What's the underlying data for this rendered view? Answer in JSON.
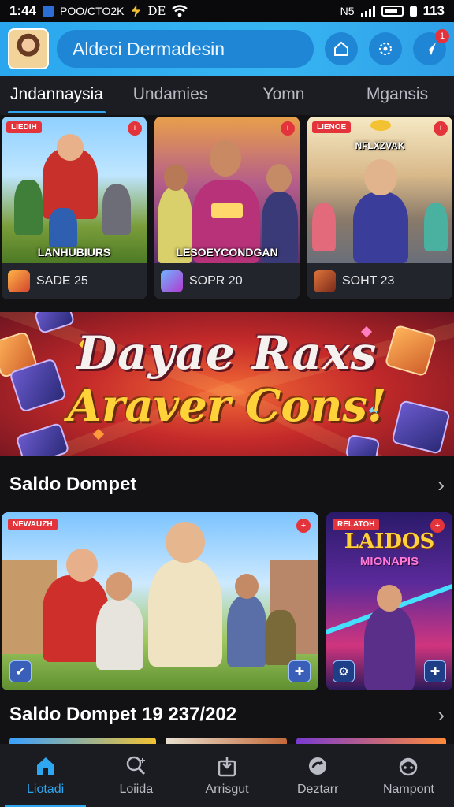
{
  "status_bar": {
    "time": "1:44",
    "carrier": "POO/CTO2K",
    "extra": "DE",
    "network": "N5",
    "battery": "113"
  },
  "header": {
    "search_text": "Aldeci Dermadesin",
    "notification_badge": "1",
    "accent": "#2aa6ee"
  },
  "tabs": [
    {
      "label": "Jndannaysia",
      "active": true
    },
    {
      "label": "Undamies",
      "active": false
    },
    {
      "label": "Yomn",
      "active": false
    },
    {
      "label": "Mgansis",
      "active": false
    }
  ],
  "games": [
    {
      "tag": "LIEDIH",
      "title": "LANHUBIURS",
      "subtitle": "SADE 25"
    },
    {
      "tag": "",
      "title": "LESOEYCONDGAN",
      "subtitle": "SOPR 20"
    },
    {
      "tag": "LIENOE",
      "title": "NFLXZVAK",
      "subtitle": "SOHT 23"
    }
  ],
  "banner": {
    "line1": "Dayae Raxs",
    "line2": "Araver Cons!"
  },
  "section1": {
    "title": "Saldo Dompet"
  },
  "featured": [
    {
      "tag": "NEWAUZH"
    },
    {
      "tag": "RELATOH",
      "title_line1": "LAIDOS",
      "title_line2": "MIONAPIS"
    }
  ],
  "section2": {
    "title": "Saldo Dompet 19 237/202"
  },
  "bottom_nav": [
    {
      "label": "Liotadi",
      "icon": "home-icon",
      "active": true
    },
    {
      "label": "Loiida",
      "icon": "search-add-icon",
      "active": false
    },
    {
      "label": "Arrisgut",
      "icon": "bag-icon",
      "active": false
    },
    {
      "label": "Deztarr",
      "icon": "refresh-icon",
      "active": false
    },
    {
      "label": "Nampont",
      "icon": "support-icon",
      "active": false
    }
  ]
}
